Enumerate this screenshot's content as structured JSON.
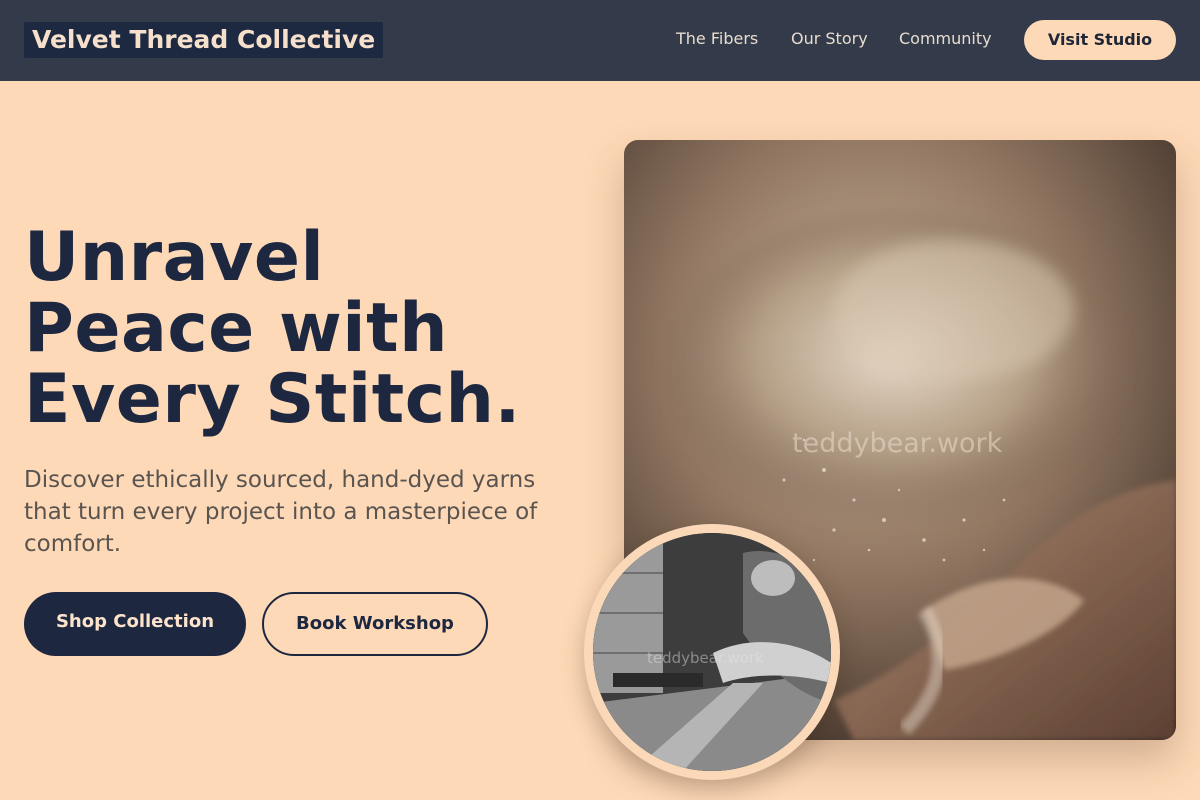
{
  "header": {
    "brand": "Velvet Thread Collective",
    "nav": [
      "The Fibers",
      "Our Story",
      "Community"
    ],
    "cta": "Visit Studio"
  },
  "hero": {
    "headline_lines": [
      "Unravel",
      "Peace with",
      "Every Stitch."
    ],
    "subtext": "Discover ethically sourced, hand-dyed yarns that turn every project into a masterpiece of comfort.",
    "primary_button": "Shop Collection",
    "secondary_button": "Book Workshop"
  },
  "images": {
    "main_watermark": "teddybear.work",
    "inset_watermark": "teddybear.work"
  },
  "colors": {
    "page_bg": "#fed9b7",
    "header_bg": "#333a49",
    "navy": "#1d2840"
  }
}
